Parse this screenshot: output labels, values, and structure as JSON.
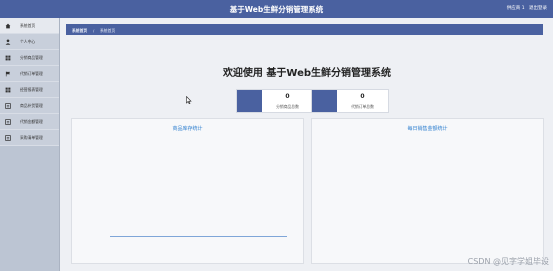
{
  "header": {
    "title": "基于Web生鲜分销管理系统",
    "user_label": "供应商 1",
    "logout_label": "退出登录"
  },
  "sidebar": {
    "items": [
      {
        "label": "系统首页",
        "icon": "home-icon"
      },
      {
        "label": "个人中心",
        "icon": "user-icon"
      },
      {
        "label": "分销商品管理",
        "icon": "grid-icon"
      },
      {
        "label": "代销订单管理",
        "icon": "flag-icon"
      },
      {
        "label": "经营报表管理",
        "icon": "grid-icon"
      },
      {
        "label": "商品补货管理",
        "icon": "list-icon"
      },
      {
        "label": "代销金额管理",
        "icon": "list-icon"
      },
      {
        "label": "采购清单管理",
        "icon": "list-icon"
      }
    ]
  },
  "breadcrumb": {
    "first": "系统首页",
    "separator": "/",
    "current": "系统首页"
  },
  "main": {
    "welcome": "欢迎使用 基于Web生鲜分销管理系统"
  },
  "stats": [
    {
      "value": "0",
      "label": "分销商品总数"
    },
    {
      "value": "0",
      "label": "代销订单总数"
    }
  ],
  "panels": [
    {
      "title": "商品库存统计"
    },
    {
      "title": "每日销售金额统计"
    }
  ],
  "watermark": "CSDN @见字学姐毕设",
  "colors": {
    "accent": "#4a61a0",
    "panel_title": "#2f7fcf",
    "sidebar": "#bcc5d3"
  }
}
